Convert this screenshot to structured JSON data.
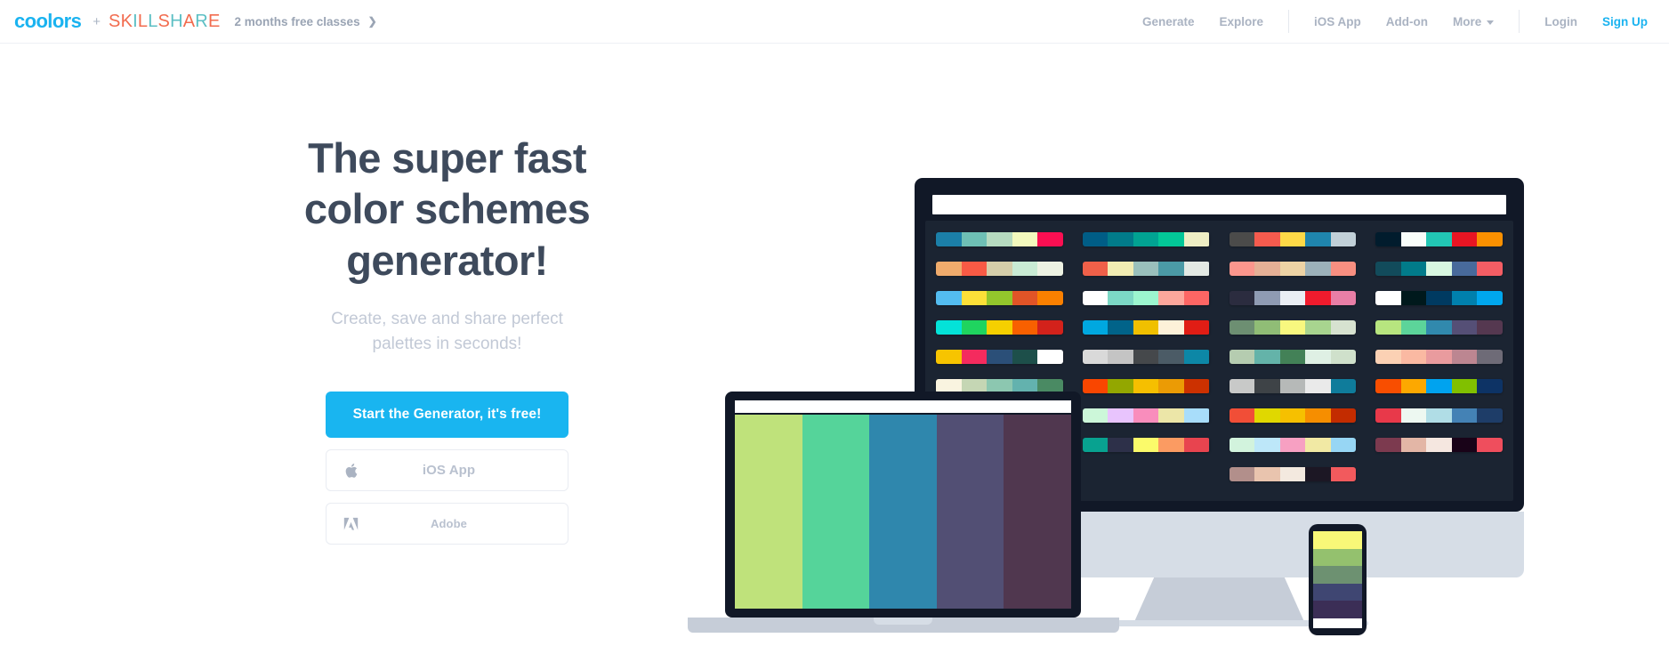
{
  "navbar": {
    "logo": {
      "coolors": "coolors",
      "plus": "+",
      "skillshare_letters": [
        {
          "ch": "S",
          "c": "orange"
        },
        {
          "ch": "K",
          "c": "orange"
        },
        {
          "ch": "I",
          "c": "teal"
        },
        {
          "ch": "L",
          "c": "orange"
        },
        {
          "ch": "L",
          "c": "teal"
        },
        {
          "ch": "S",
          "c": "orange"
        },
        {
          "ch": "H",
          "c": "teal"
        },
        {
          "ch": "A",
          "c": "orange"
        },
        {
          "ch": "R",
          "c": "teal"
        },
        {
          "ch": "E",
          "c": "orange"
        }
      ],
      "skillshare_text": "SKILLSHARE",
      "brand_blue": "#1ab3f0",
      "skillshare_orange": "#f26c4f",
      "skillshare_teal": "#5cbfc4"
    },
    "promo": {
      "text": "2 months free classes",
      "arrow": "❯"
    },
    "links_left": [
      {
        "label": "Generate",
        "name": "nav-generate"
      },
      {
        "label": "Explore",
        "name": "nav-explore"
      }
    ],
    "links_mid": [
      {
        "label": "iOS App",
        "name": "nav-ios-app"
      },
      {
        "label": "Add-on",
        "name": "nav-add-on"
      },
      {
        "label": "More",
        "name": "nav-more",
        "caret": true
      }
    ],
    "links_right": [
      {
        "label": "Login",
        "name": "nav-login",
        "accent": false
      },
      {
        "label": "Sign Up",
        "name": "nav-sign-up",
        "accent": true
      }
    ]
  },
  "hero": {
    "title_lines": [
      "The super fast",
      "color schemes",
      "generator!"
    ],
    "title": "The super fast color schemes generator!",
    "subtitle_lines": [
      "Create, save and share perfect",
      "palettes in seconds!"
    ],
    "subtitle": "Create, save and share perfect palettes in seconds!",
    "cta_primary": "Start the Generator, it's free!",
    "cta_primary_color": "#19b5f0",
    "buttons": [
      {
        "label": "iOS App",
        "icon": "apple-icon"
      },
      {
        "label": "Adobe",
        "icon": "adobe-icon"
      }
    ]
  },
  "illustration": {
    "monitor_palettes": [
      [
        "#1b7fa8",
        "#6ec0b5",
        "#b6dbc0",
        "#f2f9bd",
        "#fa0f52"
      ],
      [
        "#efab6c",
        "#f85a45",
        "#d5ceaa",
        "#c9ebd4",
        "#edf2e3"
      ],
      [
        "#53bcf0",
        "#fce038",
        "#93c62c",
        "#e15427",
        "#fa8000"
      ],
      [
        "#04e2d8",
        "#1fd45f",
        "#f5d000",
        "#f86000",
        "#d3221b"
      ],
      [
        "#f7c400",
        "#f42b5e",
        "#2b4f78",
        "#1d4f4a",
        "#ffffff"
      ],
      [
        "#f9f4e0",
        "#c5d6b4",
        "#8cc7b0",
        "#63b2ae",
        "#4a8a63"
      ],
      [
        "#d6e2e0",
        "#fde8de",
        "#fbc9d3",
        "#f4a7b3",
        "#a9888f"
      ],
      [
        "#a391cc",
        "#f0a0ca",
        "#f3d6f1",
        "#eee9f2",
        "#b9bee3"
      ],
      [
        "#5f7280",
        "#5ebdb7",
        "#c5f8fb",
        "#dcfaec",
        "#ffffff"
      ],
      [
        "#005d86",
        "#017b8a",
        "#01a392",
        "#03c798",
        "#eeeec4"
      ],
      [
        "#ef6049",
        "#f1ecb3",
        "#9ac0bc",
        "#4b9aa6",
        "#e3e9e4"
      ],
      [
        "#ffffff",
        "#7cd8c5",
        "#9cf6cf",
        "#fca79c",
        "#fd6664"
      ],
      [
        "#00a8e0",
        "#016389",
        "#f0c000",
        "#fdf1d9",
        "#e01d15"
      ],
      [
        "#d9d9d9",
        "#c4c4c4",
        "#45484b",
        "#4b5b66",
        "#0d87a6"
      ],
      [
        "#f94600",
        "#93a700",
        "#f6bf00",
        "#eb9b05",
        "#cc3100"
      ],
      [
        "#ccf7d9",
        "#e8c4fd",
        "#f98dbc",
        "#ece6a8",
        "#a8ddfa"
      ],
      [
        "#08a290",
        "#2d3049",
        "#fbfa6a",
        "#fb9b62",
        "#e8444f"
      ],
      [
        "#4b4b4a",
        "#f55b4e",
        "#fdd947",
        "#1f85ad",
        "#c1d0d8"
      ],
      [
        "#fb968d",
        "#e5b096",
        "#edd3a5",
        "#9cb1ba",
        "#f88f81"
      ],
      [
        "#2b2c3f",
        "#8f9bb3",
        "#eaeef4",
        "#f01b2d",
        "#e87ea6"
      ],
      [
        "#6d8f72",
        "#90bd76",
        "#f8f87f",
        "#a8d48f",
        "#d7e2d0"
      ],
      [
        "#b5ccb0",
        "#64b3a9",
        "#438157",
        "#dff0e4",
        "#cfe0cb"
      ],
      [
        "#c8c9c8",
        "#3e4347",
        "#b6b9b8",
        "#eaeaea",
        "#0f7c9b"
      ],
      [
        "#f14e37",
        "#e0d800",
        "#f6c000",
        "#f68e00",
        "#c32c00"
      ],
      [
        "#d2f3dd",
        "#bde7f9",
        "#f7a0c2",
        "#f1e9a4",
        "#97d6f4"
      ],
      [
        "#b28f8b",
        "#e9c4ae",
        "#f3e9df",
        "#1c1724",
        "#f25a5d"
      ],
      [
        "#011c2d",
        "#f8fdfa",
        "#22c6b4",
        "#e81523",
        "#fa9000"
      ],
      [
        "#124b5b",
        "#017b8a",
        "#d8f7e1",
        "#486a9b",
        "#f45d64"
      ],
      [
        "#ffffff",
        "#00191c",
        "#003a61",
        "#0080ad",
        "#00a7ee"
      ],
      [
        "#b7e57f",
        "#5cd49a",
        "#3189ad",
        "#554f76",
        "#553850"
      ],
      [
        "#fbd1b4",
        "#fab9a2",
        "#e99b9e",
        "#bc8691",
        "#6e6b77"
      ],
      [
        "#f84e00",
        "#fda800",
        "#00a3ef",
        "#81c000",
        "#0d3365"
      ],
      [
        "#e8394a",
        "#edf8f1",
        "#b0dde6",
        "#4482b5",
        "#1e3d68"
      ],
      [
        "#7c3a4f",
        "#e3b6a6",
        "#f5e7e0",
        "#190318",
        "#ef4e5d"
      ]
    ],
    "laptop_palette": [
      "#bfe27b",
      "#55d49a",
      "#2f87ad",
      "#524f74",
      "#50374f"
    ],
    "phone_palette": [
      "#f8f878",
      "#94c16e",
      "#6d9171",
      "#3f4672",
      "#3b2e56"
    ],
    "phone_bottom_bar": "#ffffff",
    "monitor_frame": "#111827",
    "monitor_screen_bg": "#1b2432",
    "device_body": "#d6dde6",
    "device_stand": "#c6cdd8"
  }
}
